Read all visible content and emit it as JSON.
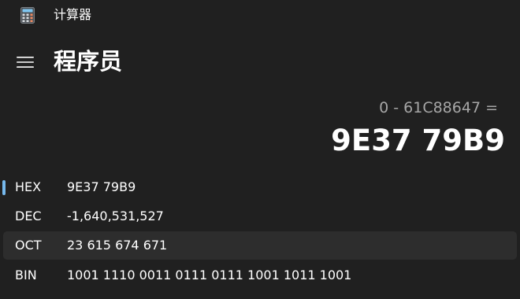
{
  "app": {
    "title": "计算器",
    "icon": "calculator-icon"
  },
  "header": {
    "menu_icon": "hamburger-menu-icon",
    "mode_title": "程序员"
  },
  "display": {
    "expression": "0 - 61C88647 =",
    "result": "9E37 79B9"
  },
  "radix": {
    "selected": "HEX",
    "accent_color": "#76b9ed",
    "rows": [
      {
        "label": "HEX",
        "value": "9E37 79B9"
      },
      {
        "label": "DEC",
        "value": "-1,640,531,527"
      },
      {
        "label": "OCT",
        "value": "23 615 674 671"
      },
      {
        "label": "BIN",
        "value": "1001 1110 0011 0111 0111 1001 1011 1001"
      }
    ]
  },
  "colors": {
    "background": "#202020",
    "row_hover": "#2d2d2d",
    "secondary_text": "#a6a6a6"
  }
}
